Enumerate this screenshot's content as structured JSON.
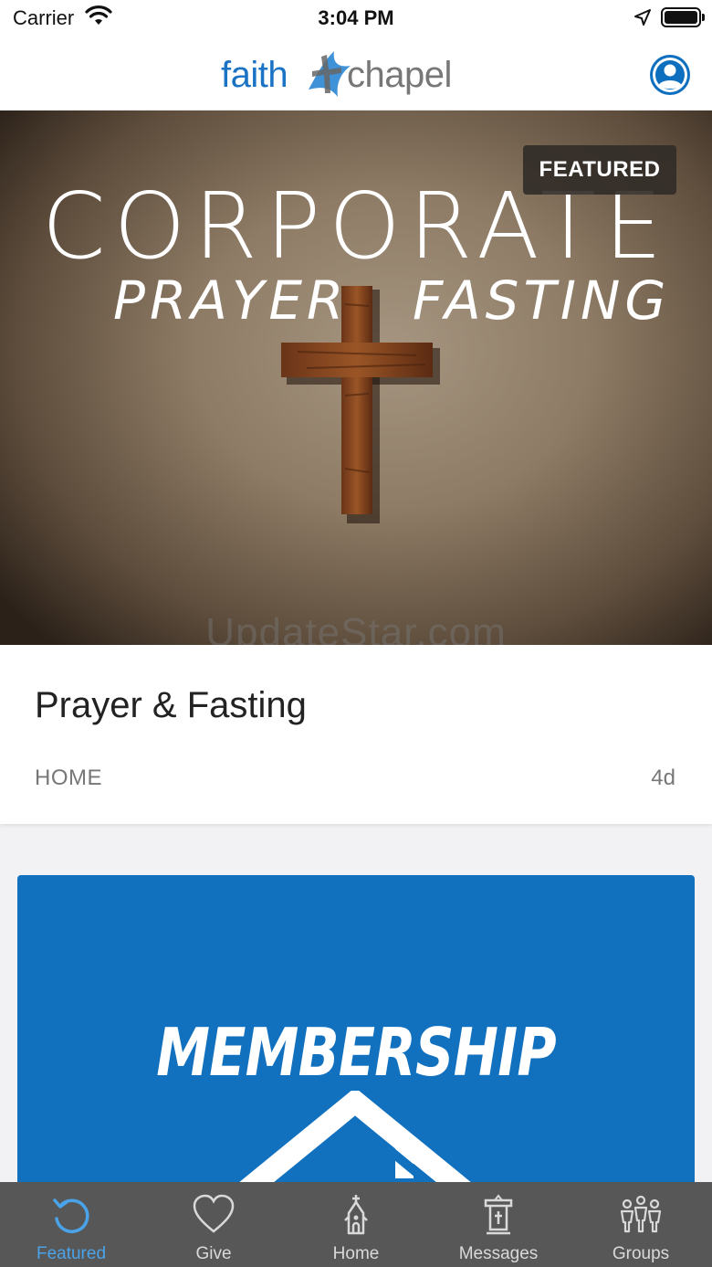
{
  "status_bar": {
    "carrier": "Carrier",
    "time": "3:04 PM"
  },
  "header": {
    "logo_word_1": "faith",
    "logo_word_2": "chapel",
    "profile_icon": "user-circle-icon"
  },
  "featured_card": {
    "badge": "FEATURED",
    "image_title": "CORPORATE",
    "image_subtitle_left": "PRAYER",
    "image_subtitle_right": "FASTING",
    "watermark": "UpdateStar.com",
    "title": "Prayer & Fasting",
    "category": "HOME",
    "age": "4d"
  },
  "second_card": {
    "image_text": "MEMBERSHIP",
    "color": "#1271bf"
  },
  "tab_bar": {
    "tabs": [
      {
        "label": "Featured",
        "icon": "refresh-icon",
        "active": true
      },
      {
        "label": "Give",
        "icon": "heart-icon",
        "active": false
      },
      {
        "label": "Home",
        "icon": "church-icon",
        "active": false
      },
      {
        "label": "Messages",
        "icon": "pulpit-icon",
        "active": false
      },
      {
        "label": "Groups",
        "icon": "people-icon",
        "active": false
      }
    ],
    "active_color": "#4aa3e8",
    "background": "#575757"
  }
}
